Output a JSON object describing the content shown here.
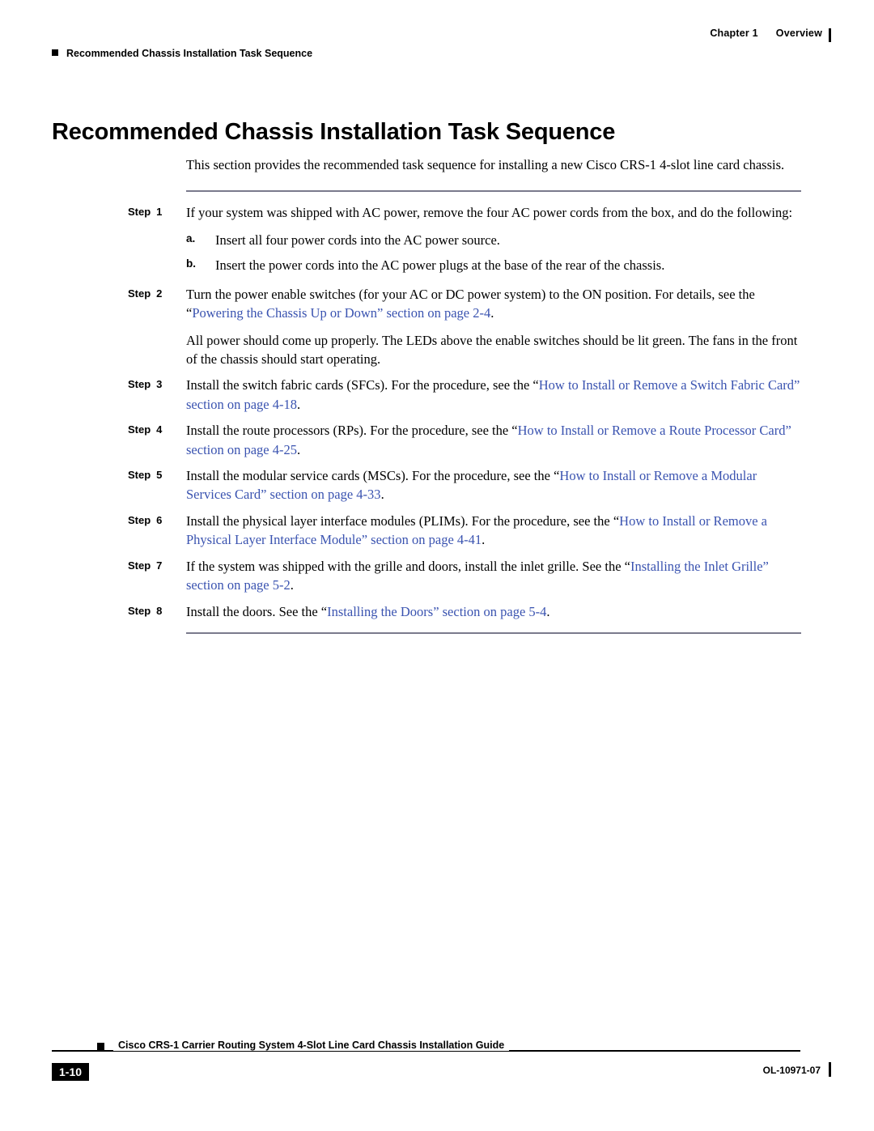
{
  "header": {
    "chapter_label": "Chapter 1",
    "chapter_title": "Overview",
    "running_head": "Recommended Chassis Installation Task Sequence"
  },
  "page_title": "Recommended Chassis Installation Task Sequence",
  "intro": "This section provides the recommended task sequence for installing a new Cisco CRS-1 4-slot line card chassis.",
  "step_word": "Step",
  "steps": [
    {
      "num": "1",
      "text": "If your system was shipped with AC power, remove the four AC power cords from the box, and do the following:",
      "sub": [
        {
          "marker": "a.",
          "text": "Insert all four power cords into the AC power source."
        },
        {
          "marker": "b.",
          "text": "Insert the power cords into the AC power plugs at the base of the rear of the chassis."
        }
      ]
    },
    {
      "num": "2",
      "pre": "Turn the power enable switches (for your AC or DC power system) to the ON position. For details, see the “",
      "link": "Powering the Chassis Up or Down” section on page 2-4",
      "post": ".",
      "para2": "All power should come up properly. The LEDs above the enable switches should be lit green. The fans in the front of the chassis should start operating."
    },
    {
      "num": "3",
      "pre": "Install the switch fabric cards (SFCs). For the procedure, see the “",
      "link": "How to Install or Remove a Switch Fabric Card” section on page 4-18",
      "post": "."
    },
    {
      "num": "4",
      "pre": "Install the route processors (RPs). For the procedure, see the “",
      "link": "How to Install or Remove a Route Processor Card” section on page 4-25",
      "post": "."
    },
    {
      "num": "5",
      "pre": "Install the modular service cards (MSCs). For the procedure, see the “",
      "link": "How to Install or Remove a Modular Services Card” section on page 4-33",
      "post": "."
    },
    {
      "num": "6",
      "pre": "Install the physical layer interface modules (PLIMs). For the procedure, see the “",
      "link": "How to Install or Remove a Physical Layer Interface Module” section on page 4-41",
      "post": "."
    },
    {
      "num": "7",
      "pre": "If the system was shipped with the grille and doors, install the inlet grille. See the “",
      "link": "Installing the Inlet Grille” section on page 5-2",
      "post": "."
    },
    {
      "num": "8",
      "pre": "Install the doors. See the “",
      "link": "Installing the Doors” section on page 5-4",
      "post": "."
    }
  ],
  "footer": {
    "book_title": "Cisco CRS-1 Carrier Routing System 4-Slot Line Card Chassis Installation Guide",
    "page_number": "1-10",
    "doc_id": "OL-10971-07"
  },
  "colors": {
    "link": "#3a53b0",
    "rule": "#7a7a8c"
  }
}
